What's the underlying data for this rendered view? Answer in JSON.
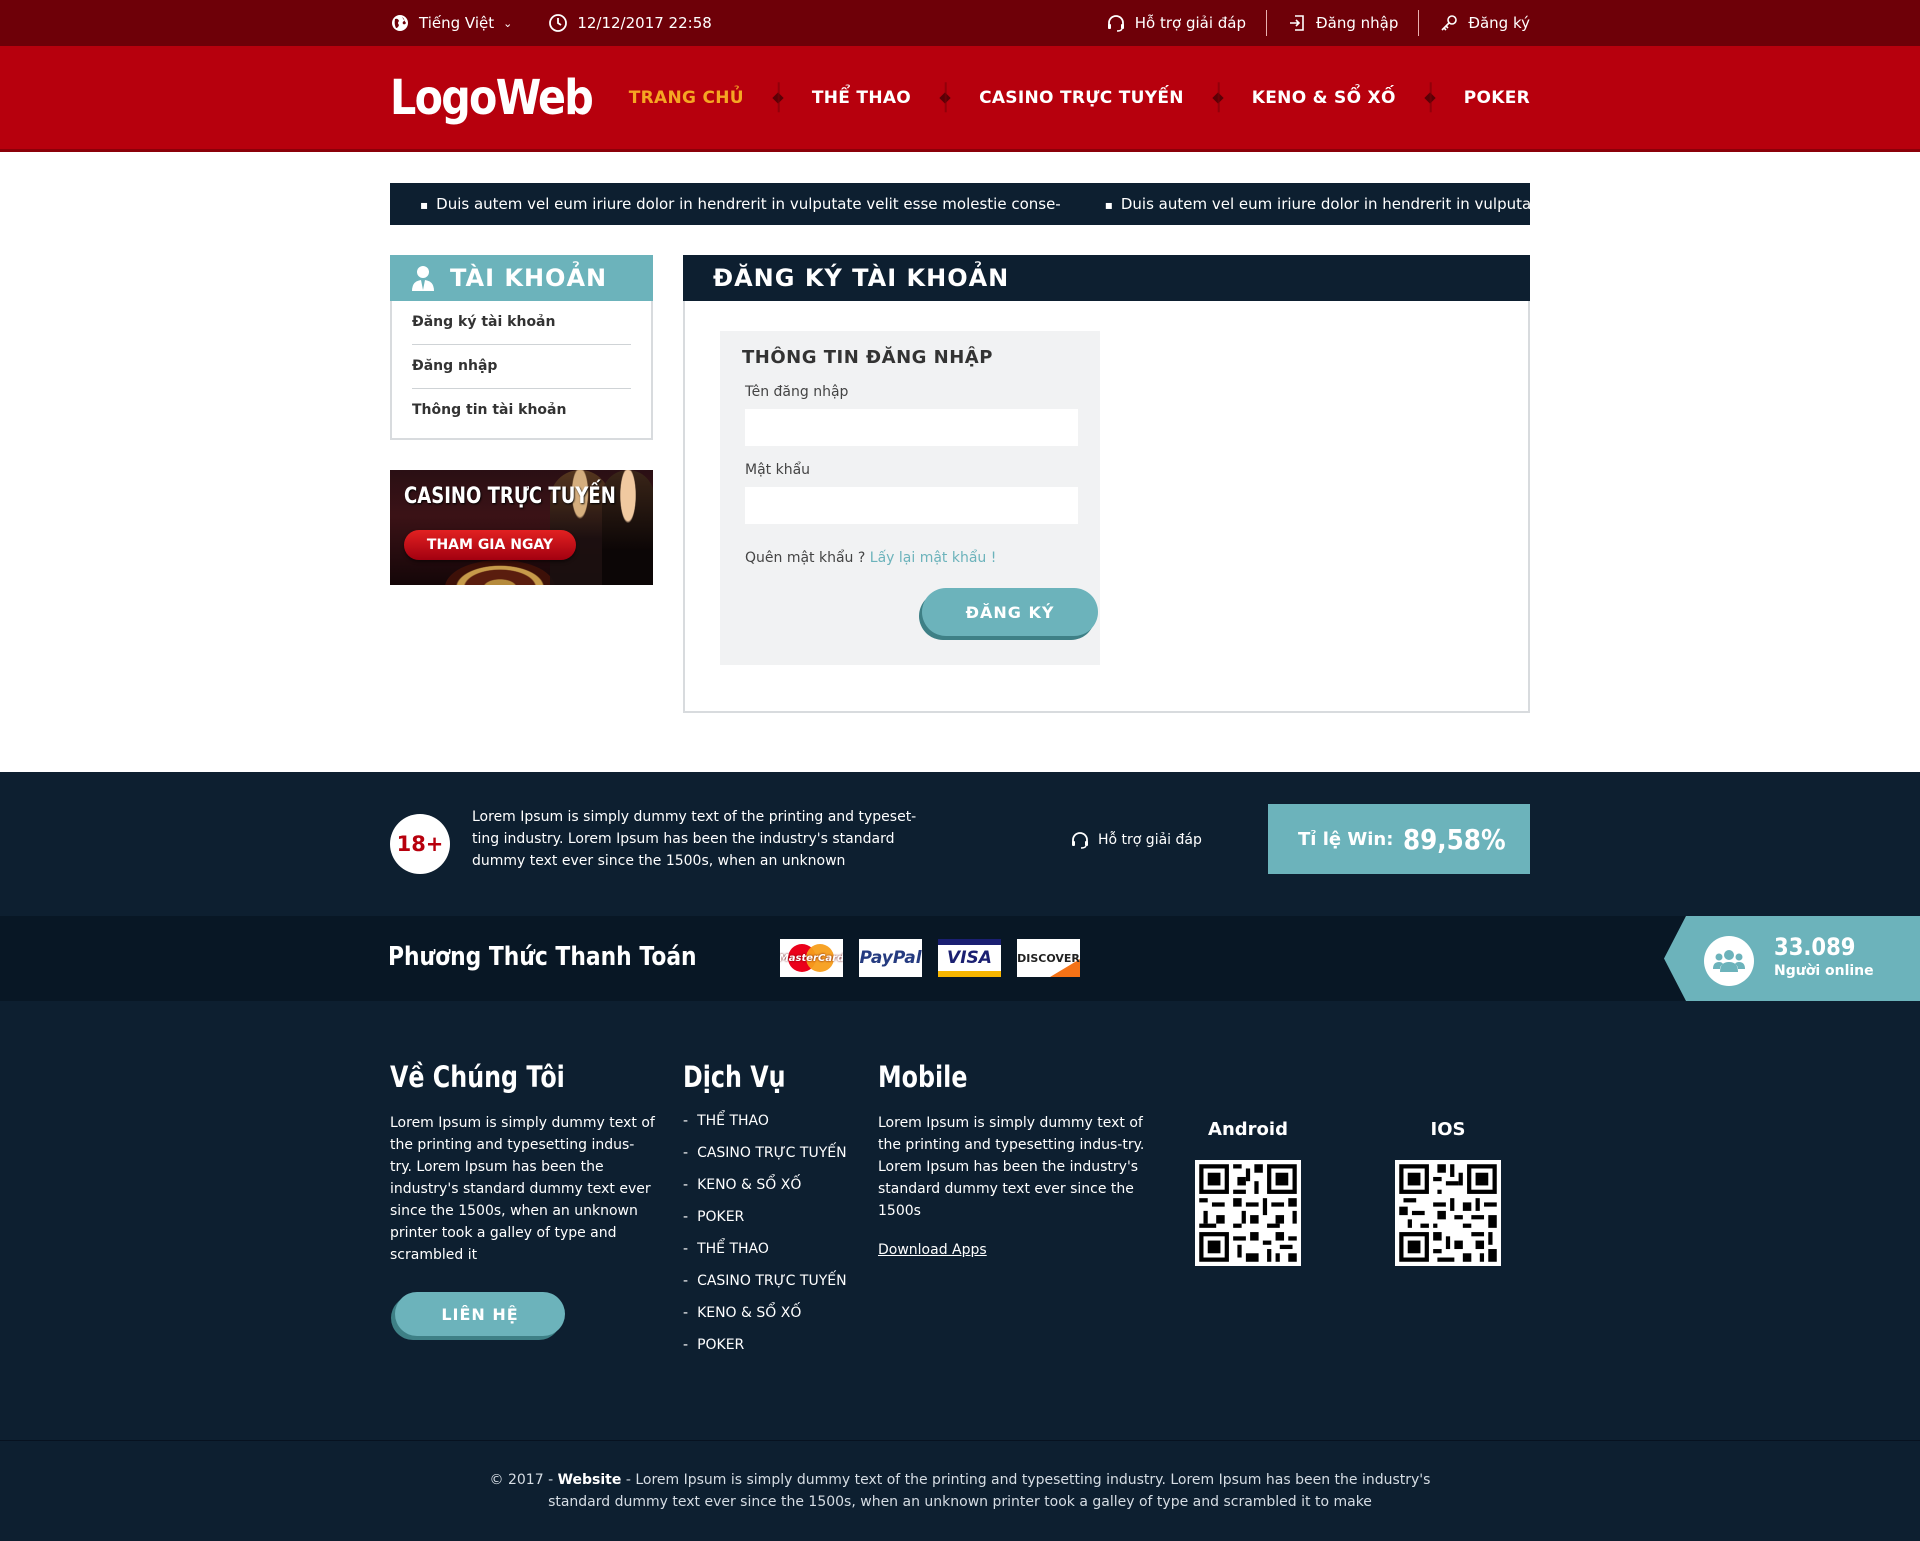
{
  "topbar": {
    "language": "Tiếng Việt",
    "datetime": "12/12/2017 22:58",
    "support": "Hỗ trợ giải đáp",
    "login": "Đăng nhập",
    "register": "Đăng ký"
  },
  "header": {
    "logo": "LogoWeb",
    "nav": [
      "TRANG CHỦ",
      "THỂ THAO",
      "CASINO TRỰC TUYẾN",
      "KENO & SỔ XỐ",
      "POKER"
    ],
    "active_nav": "TRANG CHỦ"
  },
  "ticker": [
    "Duis autem vel eum iriure dolor in hendrerit in vulputate velit esse molestie conse-",
    "Duis autem vel eum iriure dolor in hendrerit in vulputate"
  ],
  "sidebar": {
    "title": "TÀI KHOẢN",
    "items": [
      "Đăng ký tài khoản",
      "Đăng nhập",
      "Thông tin tài khoản"
    ],
    "banner": {
      "title": "CASINO TRỰC TUYẾN",
      "button": "THAM GIA NGAY"
    }
  },
  "content": {
    "title": "ĐĂNG KÝ TÀI KHOẢN",
    "form": {
      "title": "THÔNG TIN ĐĂNG NHẬP",
      "username_label": "Tên đăng nhập",
      "username_value": "",
      "password_label": "Mật khẩu",
      "password_value": "",
      "forgot_text": "Quên mật khẩu ?",
      "forgot_link": "Lấy lại mật khẩu !",
      "submit": "ĐĂNG KÝ"
    }
  },
  "footer_top": {
    "age_badge": "18+",
    "text": "Lorem Ipsum is simply dummy text of the printing and typeset-ting industry. Lorem Ipsum has been the industry's standard dummy text ever since the 1500s, when an unknown",
    "support": "Hỗ trợ giải đáp",
    "win_label": "Tỉ lệ Win:",
    "win_value": "89,58%"
  },
  "payment": {
    "title": "Phương Thức Thanh Toán",
    "cards": [
      "MasterCard",
      "PayPal",
      "VISA",
      "DISCOVER"
    ]
  },
  "online": {
    "count": "33.089",
    "label": "Người online"
  },
  "footer": {
    "about": {
      "title": "Về Chúng Tôi",
      "text": "Lorem Ipsum is simply dummy text of the printing and typesetting indus-try. Lorem Ipsum has been the industry's standard dummy text ever since the 1500s, when an unknown printer took a galley of type and scrambled it",
      "button": "LIÊN HỆ"
    },
    "services": {
      "title": "Dịch Vụ",
      "items": [
        "THỂ THAO",
        "CASINO TRỰC TUYẾN",
        "KENO & SỔ XỐ",
        "POKER",
        "THỂ THAO",
        "CASINO TRỰC TUYẾN",
        "KENO & SỔ XỐ",
        "POKER"
      ]
    },
    "mobile": {
      "title": "Mobile",
      "text": "Lorem Ipsum is simply dummy text of the printing and typesetting indus-try. Lorem Ipsum has been the industry's standard dummy text ever since the 1500s",
      "download": "Download Apps",
      "android": "Android",
      "ios": "IOS"
    }
  },
  "copyright": {
    "prefix": "© 2017 -",
    "site": "Website",
    "text": "- Lorem Ipsum is simply dummy text of the printing and typesetting industry. Lorem Ipsum has been the industry's standard dummy text ever since the 1500s, when an unknown printer took a galley of type and scrambled it to make"
  },
  "colors": {
    "topbar": "#6e0008",
    "header": "#b7000d",
    "accent": "#6cb3bb",
    "dark": "#0d1f30",
    "active_nav": "#f5a623"
  }
}
